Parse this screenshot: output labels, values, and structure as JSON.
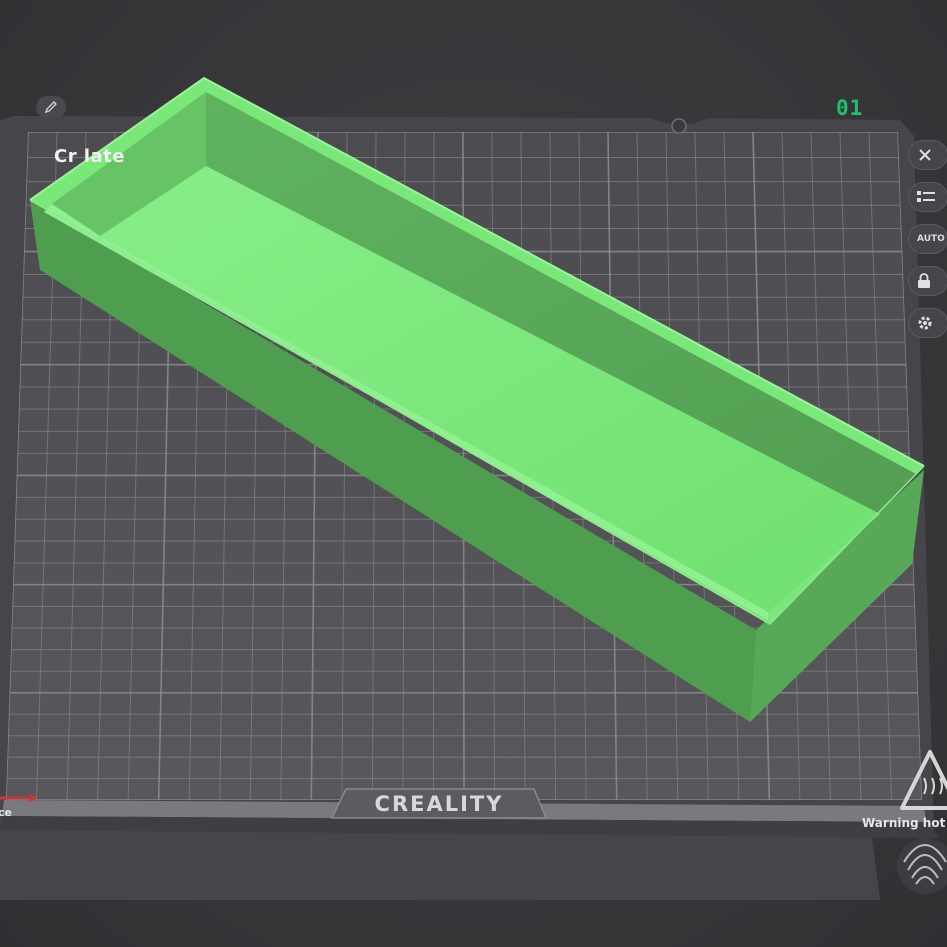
{
  "plate": {
    "label": "Cr                             late",
    "number": "01",
    "brand": "CREALITY",
    "warning": "Warning hot",
    "left_fragment": "ce"
  },
  "colors": {
    "background": "#36363a",
    "plate": "#555558",
    "grid": "#8c8c90",
    "model": "#79e879",
    "model_dark": "#4f9e4f",
    "accent": "#1fc16b"
  },
  "toolbar": {
    "items": [
      {
        "name": "close",
        "icon": "close-icon"
      },
      {
        "name": "arrange",
        "icon": "list-icon"
      },
      {
        "name": "auto-orient",
        "icon": "auto-icon",
        "label": "AUTO"
      },
      {
        "name": "lock",
        "icon": "lock-icon"
      },
      {
        "name": "settings",
        "icon": "gear-icon"
      }
    ]
  },
  "icons": {
    "edit": "pencil-icon",
    "fingerprint": "fingerprint-icon",
    "hot_warning": "hot-surface-warning-icon"
  }
}
